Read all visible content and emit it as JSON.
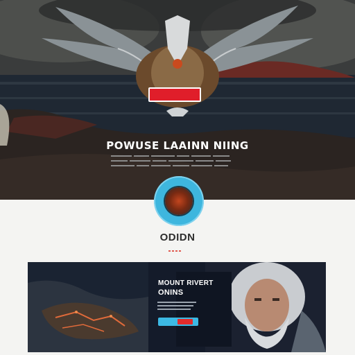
{
  "hero": {
    "cta_label": "",
    "title": "POWUSE LAAINN NIING"
  },
  "brand": {
    "name": "ODIDN"
  },
  "promo": {
    "title_line1": "MOUNT RIVERT",
    "title_line2": "ONINS"
  },
  "colors": {
    "accent_red": "#e01e2a",
    "accent_blue": "#3eb6de",
    "promo_bg": "#141b2a"
  }
}
